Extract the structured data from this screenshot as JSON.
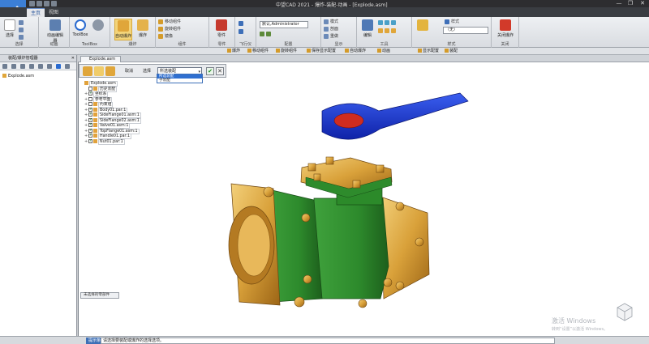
{
  "window": {
    "title": "中望CAD 2021 - 爆炸-装配-动画 - [Explode.asm]",
    "controls": [
      "—",
      "❐",
      "✕"
    ]
  },
  "ribbon_tabs": [
    {
      "label": "主页",
      "active": true
    },
    {
      "label": "视图",
      "active": false
    }
  ],
  "ribbon": {
    "groups": [
      {
        "label": "选择"
      },
      {
        "label": "动画"
      },
      {
        "label": "ToolBox"
      },
      {
        "label": "爆炸"
      },
      {
        "label": "组件"
      },
      {
        "label": "零件"
      },
      {
        "label": "飞行仪"
      },
      {
        "label": "配置"
      },
      {
        "label": "显示"
      },
      {
        "label": "工具"
      },
      {
        "label": "样式"
      },
      {
        "label": "关闭"
      }
    ],
    "buttons": {
      "select": "选择",
      "anim_edit": "动画编辑器",
      "toolbox": "ToolBox",
      "auto_explode": "自动爆炸",
      "explode": "爆炸",
      "move_comp": "移动组件",
      "rotate_comp": "旋转组件",
      "mirror": "镜像",
      "parts": "零件",
      "mode": "模式",
      "split_view": "剖面",
      "redo": "重做",
      "edit": "编辑",
      "material": "零部件",
      "close_label": "关闭爆炸"
    },
    "combo_user": "默认,Administrator",
    "combo_style": "（无）",
    "style_label": "样式"
  },
  "cmdstrip": {
    "items": [
      "爆炸",
      "移动组件",
      "旋转组件",
      "保存显示配置",
      "自动爆炸",
      "动画",
      "显示配置",
      "装配"
    ]
  },
  "left_pane": {
    "title": "装配/爆炸管理器",
    "root": "Explode.asm"
  },
  "doc_tab": "Explode.asm",
  "explode_bar": {
    "cancel": "取消",
    "select": "选择",
    "combo_value": "所选装配",
    "options": [
      "所选装配",
      "子装配"
    ],
    "ok": "✔",
    "close": "✕"
  },
  "tree": {
    "rows": [
      {
        "label": "Explode.asm",
        "indent": 0,
        "exp": "",
        "cb": false,
        "ico": true
      },
      {
        "label": "历史装配",
        "indent": 1,
        "exp": "",
        "cb": false,
        "ico": true
      },
      {
        "label": "坐标系",
        "indent": 1,
        "exp": "+",
        "cb": true,
        "ico": false
      },
      {
        "label": "参考平面",
        "indent": 1,
        "exp": "+",
        "cb": false,
        "ico": false
      },
      {
        "label": "约束组",
        "indent": 1,
        "exp": "+",
        "cb": false,
        "ico": true
      },
      {
        "label": "Body01.par:1",
        "indent": 1,
        "exp": "+",
        "cb": true,
        "ico": true
      },
      {
        "label": "SideFlange01.asm:1",
        "indent": 1,
        "exp": "+",
        "cb": true,
        "ico": true
      },
      {
        "label": "SideFlange02.asm:1",
        "indent": 1,
        "exp": "+",
        "cb": true,
        "ico": true
      },
      {
        "label": "Valve01.asm:1",
        "indent": 1,
        "exp": "+",
        "cb": true,
        "ico": true
      },
      {
        "label": "TopFlange01.asm:1",
        "indent": 1,
        "exp": "+",
        "cb": true,
        "ico": true
      },
      {
        "label": "Handle01.par:1",
        "indent": 1,
        "exp": "+",
        "cb": true,
        "ico": true
      },
      {
        "label": "Nut01.par:1",
        "indent": 1,
        "exp": "+",
        "cb": true,
        "ico": true
      }
    ]
  },
  "small_box": "未选择的零部件",
  "status": {
    "label": "提示条",
    "text": "请选择要装配或爆炸的选择选项。"
  },
  "watermark": {
    "line1": "激活 Windows",
    "line2": "转到“设置”以激活 Windows。"
  },
  "colors": {
    "brass": "#d9a13a",
    "green": "#2d8a2c",
    "blue": "#1637c9",
    "red": "#c53022",
    "accent": "#3c6fb6"
  }
}
